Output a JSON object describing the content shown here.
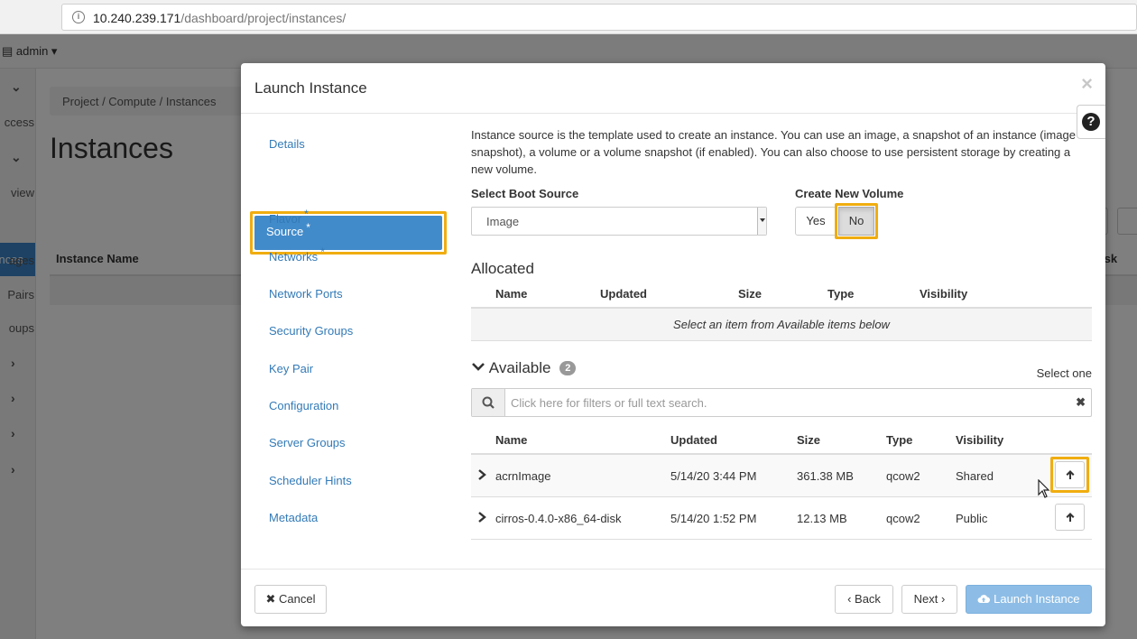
{
  "browser": {
    "url_host": "10.240.239.171",
    "url_path": "/dashboard/project/instances/"
  },
  "background": {
    "user_menu": "admin ▾",
    "sidebar_fragments": [
      "ccess",
      "view",
      "nces",
      "ages",
      "Pairs",
      "oups"
    ],
    "breadcrumb": "Project /  Compute /  Instances",
    "page_title": "Instances",
    "table_col_name": "Instance Name",
    "table_col_disk": "isk"
  },
  "modal": {
    "title": "Launch Instance",
    "close_glyph": "×",
    "help_glyph": "?",
    "nav": [
      {
        "label": "Details",
        "required": false
      },
      {
        "label": "Source",
        "required": true
      },
      {
        "label": "Flavor",
        "required": true
      },
      {
        "label": "Networks",
        "required": true
      },
      {
        "label": "Network Ports",
        "required": false
      },
      {
        "label": "Security Groups",
        "required": false
      },
      {
        "label": "Key Pair",
        "required": false
      },
      {
        "label": "Configuration",
        "required": false
      },
      {
        "label": "Server Groups",
        "required": false
      },
      {
        "label": "Scheduler Hints",
        "required": false
      },
      {
        "label": "Metadata",
        "required": false
      }
    ],
    "active_nav": "Source",
    "required_mark": "*",
    "description": "Instance source is the template used to create an instance. You can use an image, a snapshot of an instance (image snapshot), a volume or a volume snapshot (if enabled). You can also choose to use persistent storage by creating a new volume.",
    "boot_source": {
      "label": "Select Boot Source",
      "value": "Image"
    },
    "new_volume": {
      "label": "Create New Volume",
      "yes": "Yes",
      "no": "No",
      "selected": "No"
    },
    "allocated": {
      "title": "Allocated",
      "columns": [
        "Name",
        "Updated",
        "Size",
        "Type",
        "Visibility"
      ],
      "empty_text": "Select an item from Available items below"
    },
    "available": {
      "title": "Available",
      "count": "2",
      "select_hint": "Select one",
      "search_placeholder": "Click here for filters or full text search.",
      "columns": [
        "Name",
        "Updated",
        "Size",
        "Type",
        "Visibility"
      ],
      "rows": [
        {
          "name": "acrnImage",
          "updated": "5/14/20 3:44 PM",
          "size": "361.38 MB",
          "type": "qcow2",
          "visibility": "Shared"
        },
        {
          "name": "cirros-0.4.0-x86_64-disk",
          "updated": "5/14/20 1:52 PM",
          "size": "12.13 MB",
          "type": "qcow2",
          "visibility": "Public"
        }
      ]
    },
    "footer": {
      "cancel": "Cancel",
      "back": "Back",
      "next": "Next",
      "launch": "Launch Instance"
    }
  },
  "colors": {
    "highlight": "#f0ad10",
    "primary": "#428bca",
    "link": "#337ab7"
  }
}
